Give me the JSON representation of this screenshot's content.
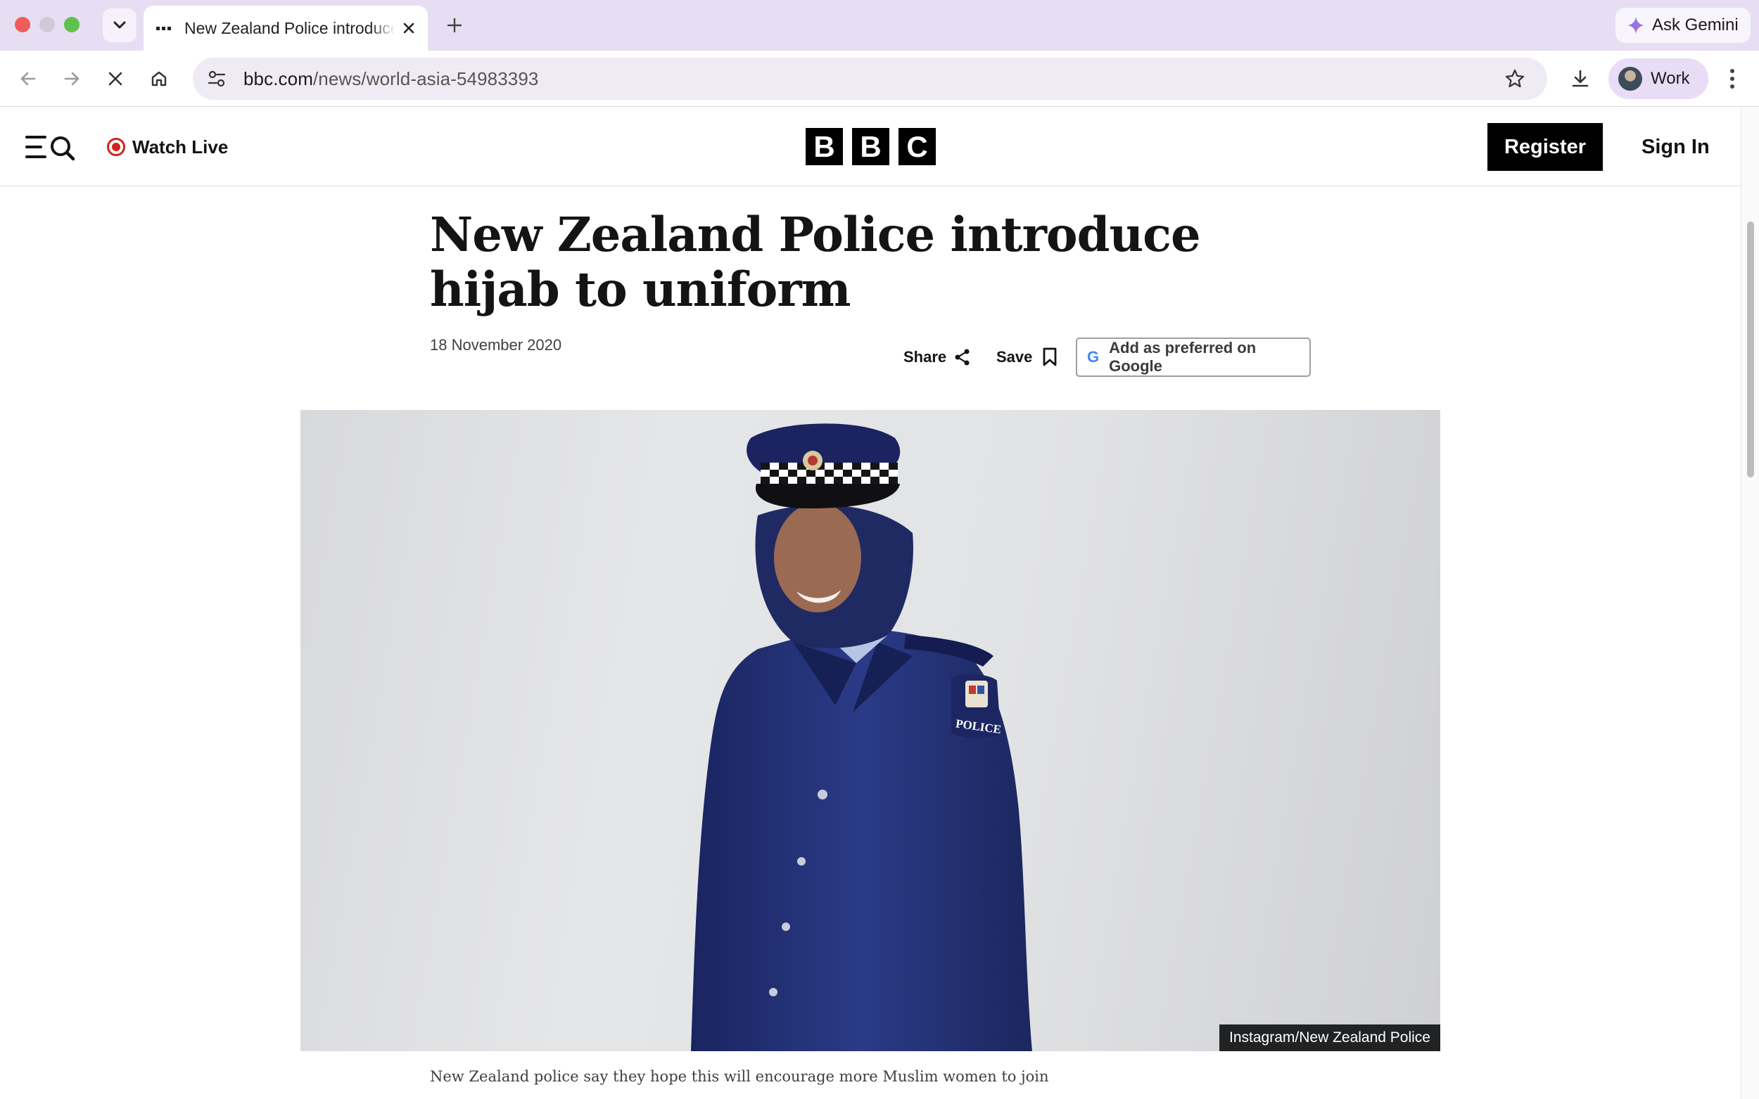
{
  "browser": {
    "tab_title": "New Zealand Police introduce hijab to uniform",
    "url_host": "bbc.com",
    "url_path": "/news/world-asia-54983393",
    "gemini_label": "Ask Gemini",
    "profile_label": "Work",
    "icons": {
      "tab_menu": "chevron-down-icon",
      "close_tab": "close-icon",
      "new_tab": "plus-icon",
      "back": "arrow-left-icon",
      "forward": "arrow-right-icon",
      "stop": "close-icon",
      "home": "home-icon",
      "site_info": "tune-icon",
      "bookmark": "star-icon",
      "download": "download-icon",
      "menu": "kebab-menu-icon",
      "gemini": "sparkle-icon"
    }
  },
  "site": {
    "watch_live_label": "Watch Live",
    "logo_letters": [
      "B",
      "B",
      "C"
    ],
    "register_label": "Register",
    "sign_in_label": "Sign In",
    "live_color": "#d1241c"
  },
  "article": {
    "headline": "New Zealand Police introduce hijab to uniform",
    "date": "18 November 2020",
    "share_label": "Share",
    "save_label": "Save",
    "google_pref_label": "Add as preferred on Google",
    "image_credit": "Instagram/New Zealand Police",
    "caption": "New Zealand police say they hope this will encourage more Muslim women to join"
  }
}
